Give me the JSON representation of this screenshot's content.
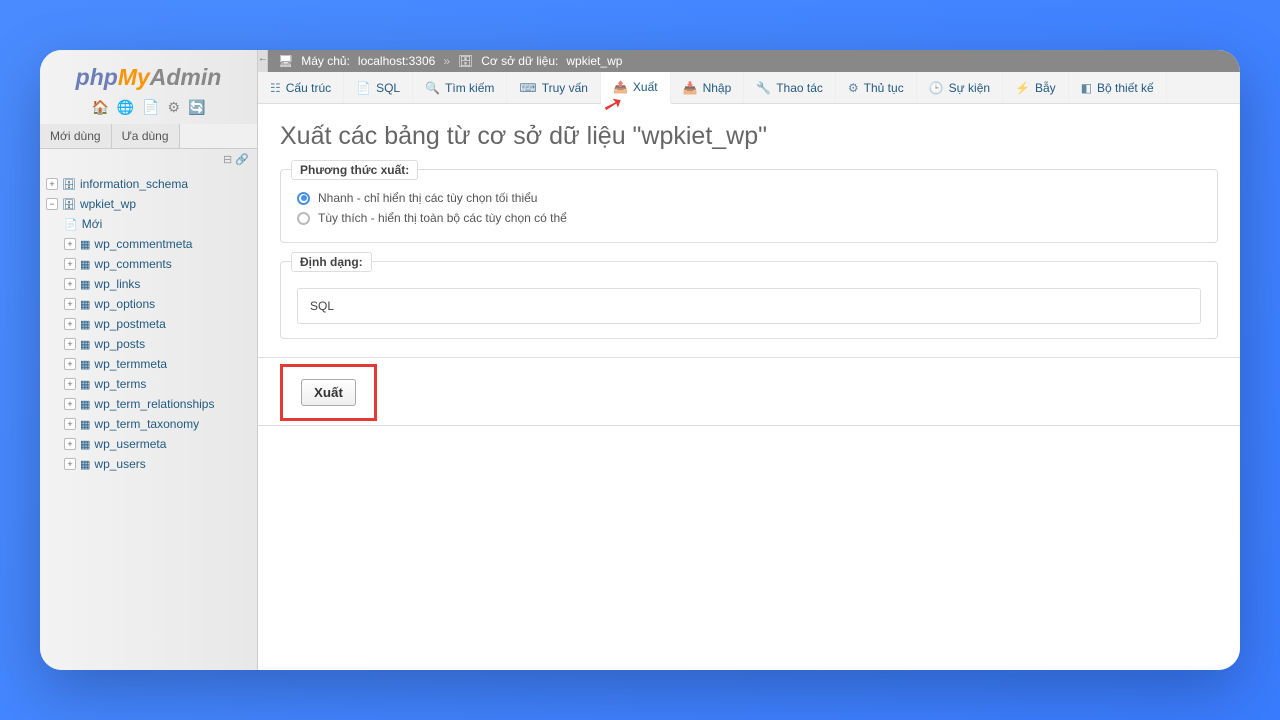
{
  "logo": {
    "p1": "php",
    "p2": "My",
    "p3": "Admin"
  },
  "sidebar_tabs": {
    "recent": "Mới dùng",
    "favorite": "Ưa dùng"
  },
  "tree": {
    "db1": "information_schema",
    "db2": "wpkiet_wp",
    "new": "Mới",
    "tables": [
      "wp_commentmeta",
      "wp_comments",
      "wp_links",
      "wp_options",
      "wp_postmeta",
      "wp_posts",
      "wp_termmeta",
      "wp_terms",
      "wp_term_relationships",
      "wp_term_taxonomy",
      "wp_usermeta",
      "wp_users"
    ]
  },
  "breadcrumb": {
    "server_prefix": "Máy chủ:",
    "server": "localhost:3306",
    "db_prefix": "Cơ sở dữ liệu:",
    "db": "wpkiet_wp"
  },
  "nav": {
    "structure": "Cấu trúc",
    "sql": "SQL",
    "search": "Tìm kiếm",
    "query": "Truy vấn",
    "export": "Xuất",
    "import": "Nhập",
    "operations": "Thao tác",
    "routines": "Thủ tục",
    "events": "Sự kiện",
    "triggers": "Bẫy",
    "designer": "Bộ thiết kế"
  },
  "page": {
    "title": "Xuất các bảng từ cơ sở dữ liệu \"wpkiet_wp\"",
    "method_legend": "Phương thức xuất:",
    "quick": "Nhanh - chỉ hiển thị các tùy chọn tối thiểu",
    "custom": "Tùy thích - hiển thị toàn bộ các tùy chọn có thể",
    "format_legend": "Định dạng:",
    "format_value": "SQL",
    "go": "Xuất"
  }
}
